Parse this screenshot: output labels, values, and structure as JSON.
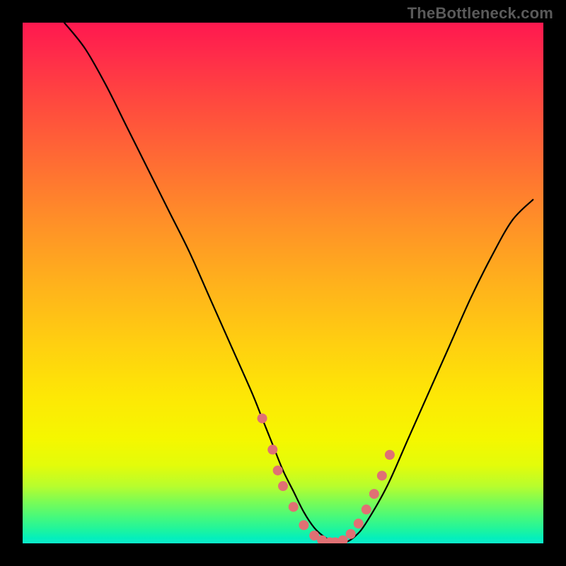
{
  "watermark": "TheBottleneck.com",
  "chart_data": {
    "type": "line",
    "title": "",
    "xlabel": "",
    "ylabel": "",
    "xlim": [
      0,
      100
    ],
    "ylim": [
      0,
      100
    ],
    "grid": false,
    "legend": false,
    "series": [
      {
        "name": "curve",
        "color": "#000000",
        "x": [
          8,
          12,
          16,
          20,
          24,
          28,
          32,
          36,
          40,
          44,
          46,
          48,
          50,
          52,
          54,
          56,
          58,
          60,
          62,
          64,
          66,
          70,
          74,
          78,
          82,
          86,
          90,
          94,
          98
        ],
        "y": [
          100,
          95,
          88,
          80,
          72,
          64,
          56,
          47,
          38,
          29,
          24,
          19,
          14,
          10,
          6,
          3,
          1.2,
          0.2,
          0.2,
          1.5,
          4,
          11,
          20,
          29,
          38,
          47,
          55,
          62,
          66
        ]
      },
      {
        "name": "highlight-markers",
        "color": "#e07074",
        "type": "scatter",
        "x": [
          46,
          48,
          49,
          50,
          52,
          54,
          56,
          57.5,
          59,
          60,
          61.5,
          63,
          64.5,
          66,
          67.5,
          69,
          70.5
        ],
        "y": [
          24,
          18,
          14,
          11,
          7,
          3.5,
          1.5,
          0.6,
          0.2,
          0.2,
          0.6,
          1.8,
          3.8,
          6.5,
          9.5,
          13,
          17
        ]
      }
    ],
    "background_gradient": {
      "stops": [
        {
          "pos": 0.0,
          "color": "#ff184f"
        },
        {
          "pos": 0.5,
          "color": "#ffb11c"
        },
        {
          "pos": 0.8,
          "color": "#f5f700"
        },
        {
          "pos": 1.0,
          "color": "#0eeccb"
        }
      ]
    }
  }
}
